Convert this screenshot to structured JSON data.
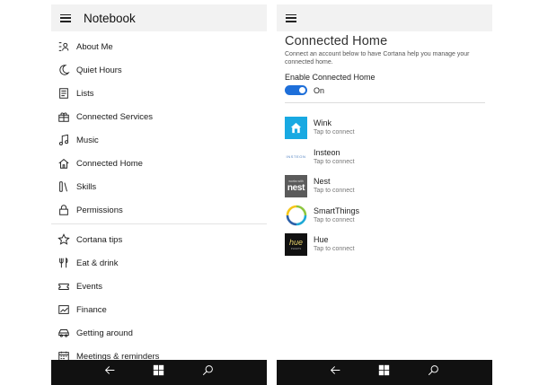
{
  "left_screen": {
    "title": "Notebook",
    "items": [
      {
        "label": "About Me",
        "icon": "about-me-icon"
      },
      {
        "label": "Quiet Hours",
        "icon": "moon-icon"
      },
      {
        "label": "Lists",
        "icon": "list-icon"
      },
      {
        "label": "Connected Services",
        "icon": "connected-services-icon"
      },
      {
        "label": "Music",
        "icon": "music-icon"
      },
      {
        "label": "Connected Home",
        "icon": "home-icon"
      },
      {
        "label": "Skills",
        "icon": "skills-icon"
      },
      {
        "label": "Permissions",
        "icon": "lock-icon"
      },
      {
        "label": "Cortana tips",
        "icon": "star-icon"
      },
      {
        "label": "Eat & drink",
        "icon": "fork-knife-icon"
      },
      {
        "label": "Events",
        "icon": "ticket-icon"
      },
      {
        "label": "Finance",
        "icon": "chart-icon"
      },
      {
        "label": "Getting around",
        "icon": "car-icon"
      },
      {
        "label": "Meetings & reminders",
        "icon": "calendar-icon"
      }
    ]
  },
  "right_screen": {
    "page_title": "Connected Home",
    "description": "Connect an account below to have Cortana help you manage your connected home.",
    "toggle_title": "Enable Connected Home",
    "toggle_state": "On",
    "toggle_value": true,
    "services": [
      {
        "name": "Wink",
        "status": "Tap to connect",
        "logo": "wink-logo"
      },
      {
        "name": "Insteon",
        "status": "Tap to connect",
        "logo": "insteon-logo",
        "logo_text": "INSTEON"
      },
      {
        "name": "Nest",
        "status": "Tap to connect",
        "logo": "nest-logo",
        "logo_text": "nest",
        "logo_small_text": "works with"
      },
      {
        "name": "SmartThings",
        "status": "Tap to connect",
        "logo": "smartthings-logo"
      },
      {
        "name": "Hue",
        "status": "Tap to connect",
        "logo": "hue-logo",
        "logo_text": "hue",
        "logo_small_text": "PHILIPS"
      }
    ]
  },
  "colors": {
    "accent": "#1e6fd9",
    "titlebar": "#f2f2f2",
    "navbar": "#111111",
    "wink": "#18a9e2"
  },
  "navbar_icons": [
    "back-icon",
    "windows-icon",
    "search-icon"
  ]
}
